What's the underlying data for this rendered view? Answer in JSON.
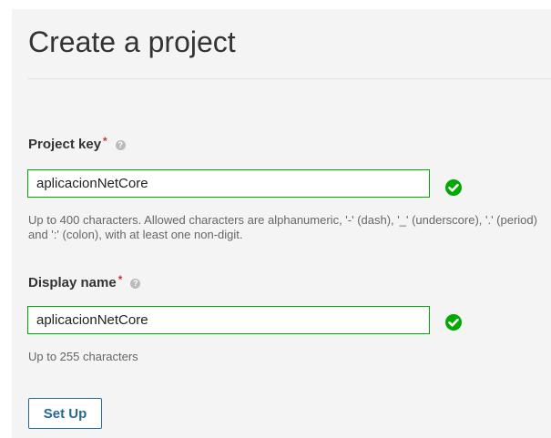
{
  "page": {
    "title": "Create a project"
  },
  "project_key": {
    "label": "Project key",
    "required_mark": "*",
    "help_glyph": "?",
    "value": "aplicacionNetCore",
    "hint": "Up to 400 characters. Allowed characters are alphanumeric, '-' (dash), '_' (underscore), '.' (period) and ':' (colon), with at least one non-digit.",
    "status_icon": "check-circle-icon"
  },
  "display_name": {
    "label": "Display name",
    "required_mark": "*",
    "help_glyph": "?",
    "value": "aplicacionNetCore",
    "hint": "Up to 255 characters",
    "status_icon": "check-circle-icon"
  },
  "actions": {
    "setup_label": "Set Up"
  },
  "colors": {
    "valid": "#00aa00",
    "required": "#d02f3a",
    "button": "#236a97",
    "panel_bg": "#f4f4f4"
  }
}
